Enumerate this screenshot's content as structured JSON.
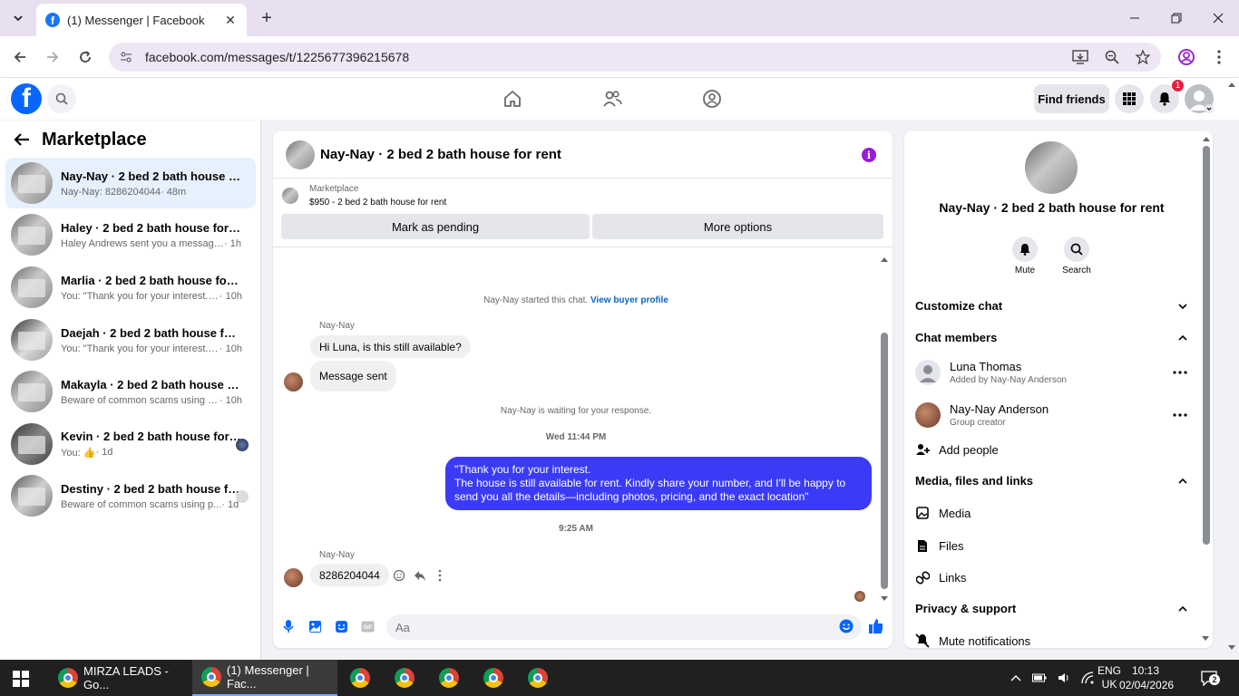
{
  "browser": {
    "tab_title": "(1) Messenger | Facebook",
    "url": "facebook.com/messages/t/1225677396215678"
  },
  "fb_header": {
    "logo": "f",
    "find_friends": "Find friends",
    "notification_count": "1"
  },
  "sidebar": {
    "title": "Marketplace",
    "conversations": [
      {
        "name": "Nay-Nay · 2 bed 2 bath house for ...",
        "snippet": "Nay-Nay: 8286204044",
        "time": " · 48m"
      },
      {
        "name": "Haley · 2 bed 2 bath house for rent",
        "snippet": "Haley Andrews sent you a message a...",
        "time": " · 1h"
      },
      {
        "name": "Marlia · 2 bed 2 bath house for rent",
        "snippet": "You: \"Thank you for your interest. Th...",
        "time": " · 10h"
      },
      {
        "name": "Daejah · 2 bed 2 bath house for rent",
        "snippet": "You: \"Thank you for your interest. Th...",
        "time": " · 10h"
      },
      {
        "name": "Makayla · 2 bed 2 bath house for r...",
        "snippet": "Beware of common scams using pay...",
        "time": " · 10h"
      },
      {
        "name": "Kevin · 2 bed 2 bath house for r...",
        "snippet": "You: 👍",
        "time": " · 1d"
      },
      {
        "name": "Destiny · 2 bed 2 bath house for...",
        "snippet": "Beware of common scams using p...",
        "time": " · 1d"
      }
    ]
  },
  "chat": {
    "title": "Nay-Nay · 2 bed 2 bath house for rent",
    "marketplace_label": "Marketplace",
    "listing": "$950 - 2 bed 2 bath house for rent",
    "mark_pending": "Mark as pending",
    "more_options": "More options",
    "started_text": "Nay-Nay started this chat.",
    "view_buyer_profile": "View buyer profile",
    "sender1": "Nay-Nay",
    "msg1": "Hi Luna, is this still available?",
    "msg2": "Message sent",
    "waiting_text": "Nay-Nay is waiting for your response.",
    "timestamp1": "Wed 11:44 PM",
    "out_msg_line1": "\"Thank you for your interest.",
    "out_msg_line2": "The house is still available for rent. Kindly share your number, and I'll be happy to send you all the details—including photos, pricing, and the exact location\"",
    "timestamp2": "9:25 AM",
    "sender2": "Nay-Nay",
    "msg3": "8286204044",
    "composer_placeholder": "Aa"
  },
  "rpanel": {
    "name": "Nay-Nay · 2 bed 2 bath house for rent",
    "mute": "Mute",
    "search": "Search",
    "customize_chat": "Customize chat",
    "chat_members": "Chat members",
    "members": [
      {
        "name": "Luna Thomas",
        "sub": "Added by Nay-Nay Anderson"
      },
      {
        "name": "Nay-Nay Anderson",
        "sub": "Group creator"
      }
    ],
    "add_people": "Add people",
    "media_files_links": "Media, files and links",
    "media": "Media",
    "files": "Files",
    "links": "Links",
    "privacy_support": "Privacy & support",
    "mute_notifications": "Mute notifications"
  },
  "taskbar": {
    "item1": "MIRZA LEADS - Go...",
    "item2": "(1) Messenger | Fac...",
    "lang1": "ENG",
    "lang2": "UK",
    "time": "10:13",
    "date": "02/04/2026",
    "notif_count": "2"
  },
  "colors": {
    "fb_blue": "#0866ff",
    "out_bubble": "#3b3bf6",
    "info_purple": "#9a1bd8",
    "active_conv": "#e7f0fd"
  }
}
